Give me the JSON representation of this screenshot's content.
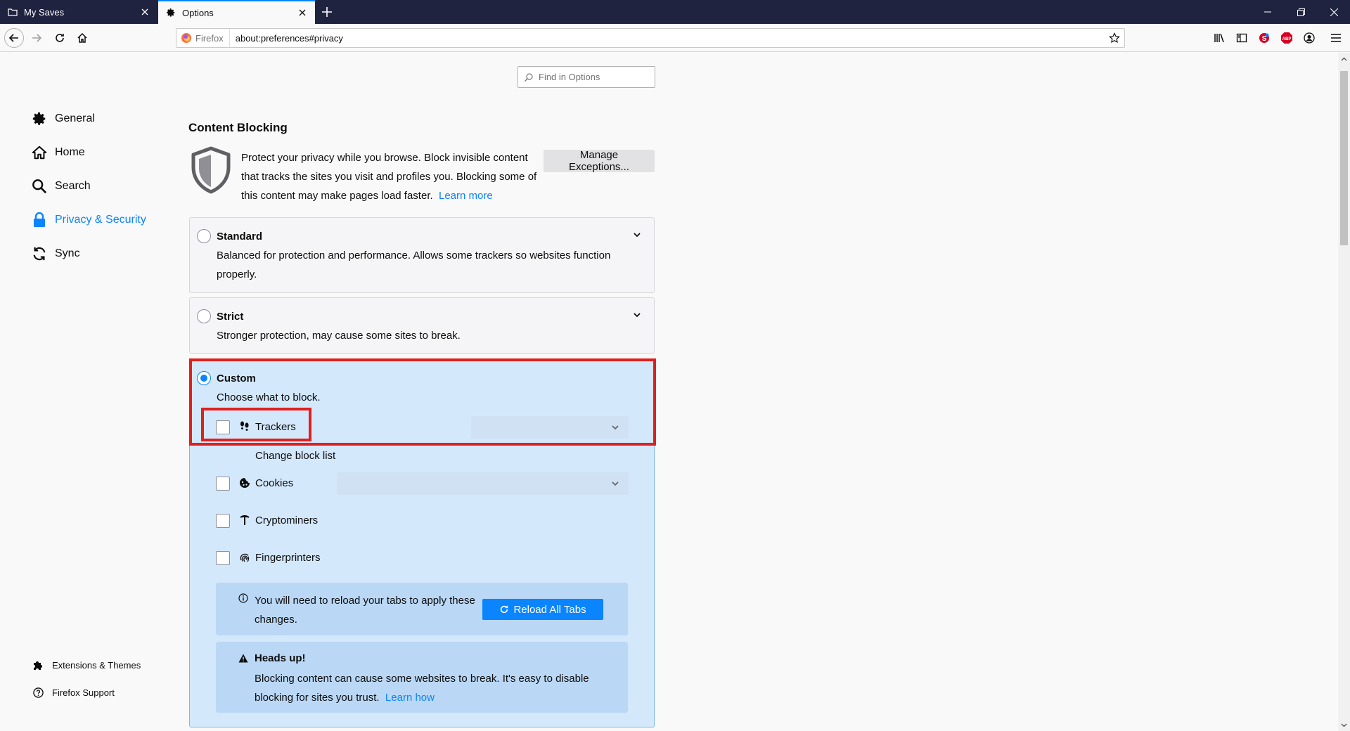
{
  "tabs": [
    {
      "title": "My Saves",
      "active": false
    },
    {
      "title": "Options",
      "active": true
    }
  ],
  "urlbar": {
    "identity_label": "Firefox",
    "url": "about:preferences#privacy"
  },
  "search": {
    "placeholder": "Find in Options"
  },
  "sidebar": {
    "categories": [
      {
        "label": "General",
        "icon": "gear-icon",
        "selected": false
      },
      {
        "label": "Home",
        "icon": "home-icon",
        "selected": false
      },
      {
        "label": "Search",
        "icon": "search-icon",
        "selected": false
      },
      {
        "label": "Privacy & Security",
        "icon": "lock-icon",
        "selected": true
      },
      {
        "label": "Sync",
        "icon": "sync-icon",
        "selected": false
      }
    ],
    "footer": [
      {
        "label": "Extensions & Themes",
        "icon": "puzzle-icon"
      },
      {
        "label": "Firefox Support",
        "icon": "help-icon"
      }
    ]
  },
  "content_blocking": {
    "title": "Content Blocking",
    "description": "Protect your privacy while you browse. Block invisible content that tracks the sites you visit and profiles you. Blocking some of this content may make pages load faster.",
    "learn_more": "Learn more",
    "manage_exceptions": "Manage Exceptions...",
    "standard": {
      "title": "Standard",
      "description": "Balanced for protection and performance. Allows some trackers so websites function properly.",
      "selected": false
    },
    "strict": {
      "title": "Strict",
      "description": "Stronger protection, may cause some sites to break.",
      "selected": false
    },
    "custom": {
      "title": "Custom",
      "description": "Choose what to block.",
      "selected": true,
      "options": {
        "trackers": {
          "label": "Trackers",
          "checked": false,
          "select_value": ""
        },
        "change_block_list": "Change block list",
        "cookies": {
          "label": "Cookies",
          "checked": false,
          "select_value": ""
        },
        "cryptominers": {
          "label": "Cryptominers",
          "checked": false
        },
        "fingerprinters": {
          "label": "Fingerprinters",
          "checked": false
        }
      },
      "reload_notice": {
        "message": "You will need to reload your tabs to apply these changes.",
        "button": "Reload All Tabs"
      },
      "warning": {
        "title": "Heads up!",
        "message": "Blocking content can cause some websites to break. It's easy to disable blocking for sites you trust.",
        "link": "Learn how"
      }
    }
  },
  "colors": {
    "accent": "#0a84ff",
    "tabstrip": "#202340",
    "highlight": "#e0201e",
    "custom_card_bg": "#d4e8fb"
  }
}
